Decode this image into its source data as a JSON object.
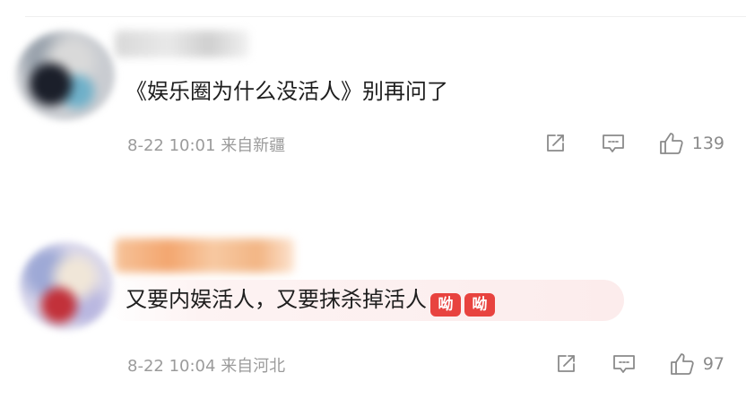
{
  "comments": [
    {
      "text": "《娱乐圈为什么没活人》别再问了",
      "time": "8-22 10:01",
      "location": "来自新疆",
      "likes": "139",
      "emojis": []
    },
    {
      "text": "又要内娱活人，又要抹杀掉活人",
      "time": "8-22 10:04",
      "location": "来自河北",
      "likes": "97",
      "emojis": [
        "呦",
        "呦"
      ]
    }
  ],
  "icons": {
    "share": "share-icon",
    "reply": "comment-icon",
    "like": "thumbs-up-icon"
  },
  "colors": {
    "text": "#1e1e1e",
    "meta": "#9b9b9b",
    "icon": "#8a8a8a",
    "emoji_bg": "#e8433f",
    "highlight_bg": "#fcecec"
  }
}
